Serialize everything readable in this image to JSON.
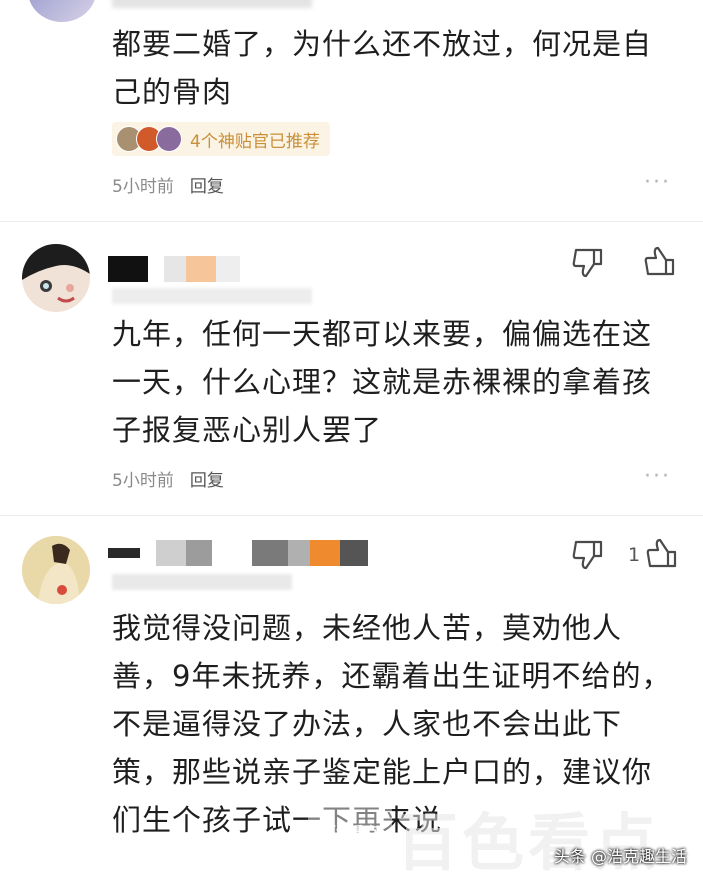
{
  "comments": [
    {
      "text": "都要二婚了，为什么还不放过，何况是自己的骨肉",
      "recommend": "4个神贴官已推荐",
      "time": "5小时前",
      "reply": "回复",
      "more": "···"
    },
    {
      "text": "九年，任何一天都可以来要，偏偏选在这一天，什么心理？这就是赤裸裸的拿着孩子报复恶心别人罢了",
      "time": "5小时前",
      "reply": "回复",
      "more": "···"
    },
    {
      "text": "我觉得没问题，未经他人苦，莫劝他人善，9年未抚养，还霸着出生证明不给的，不是逼得没了办法，人家也不会出此下策，那些说亲子鉴定能上户口的，建议你们生个孩子试一下再来说",
      "like_count": "1"
    }
  ],
  "watermark": {
    "logo": "百色看点",
    "big": "百色看点",
    "attribution": "头条 @浩克趣生活"
  },
  "icons": [
    "dislike-icon",
    "like-icon",
    "more-icon"
  ],
  "colors": {
    "badge_bg": "#fbf3e4",
    "badge_text": "#c8903a",
    "meta_text": "#8a8a8a"
  }
}
